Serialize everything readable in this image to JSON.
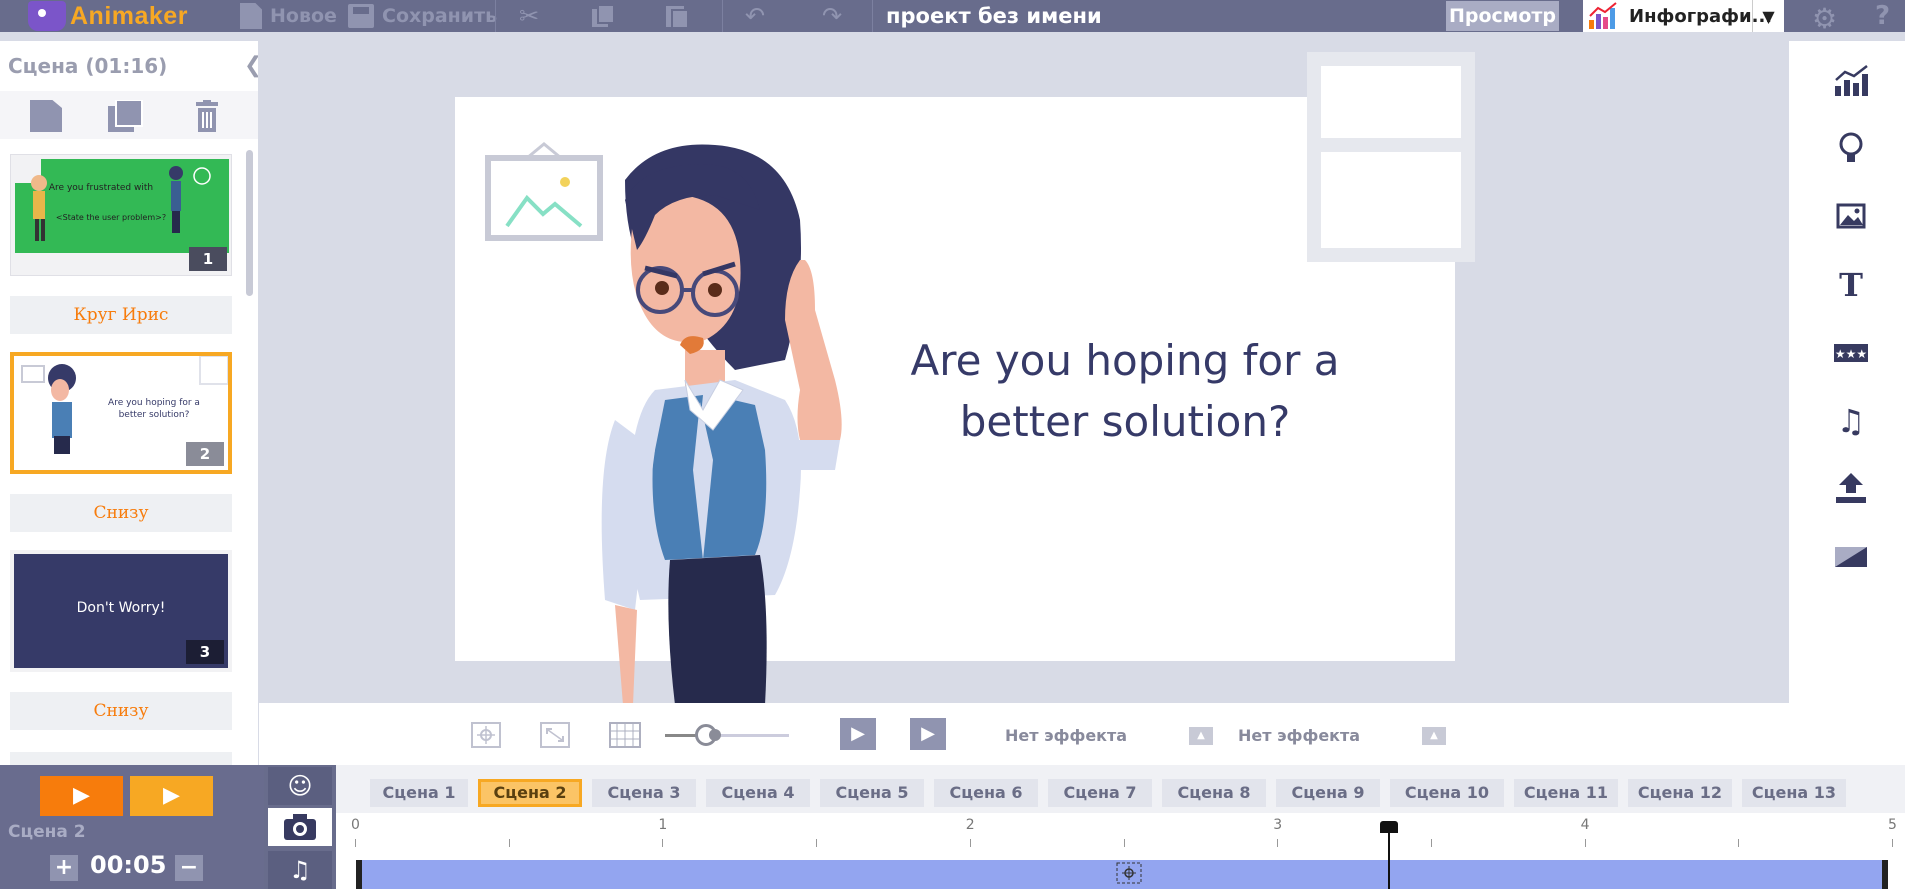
{
  "app": {
    "logo": "Animaker",
    "project_title": "проект без имени"
  },
  "toolbar": {
    "new_label": "Новое",
    "save_label": "Сохранить",
    "preview_label": "Просмотр",
    "theme_label": "Инфографи..."
  },
  "left_panel": {
    "title": "Сцена  (01:16)",
    "scenes": [
      {
        "num": "1",
        "line1": "Are you frustrated with",
        "line2": "<State the user problem>?"
      },
      {
        "num": "2",
        "line1": "Are you hoping for a",
        "line2": "better solution?"
      },
      {
        "num": "3",
        "line1": "Don't Worry!"
      }
    ],
    "transitions": [
      "Круг Ирис",
      "Снизу",
      "Снизу"
    ]
  },
  "canvas": {
    "slide_text_line1": "Are you hoping for a",
    "slide_text_line2": "better solution?"
  },
  "controls": {
    "effect_in": "Нет эффекта",
    "effect_out": "Нет эффекта",
    "zoom_level": 0.33
  },
  "timeline": {
    "current_scene": "Сцена 2",
    "duration": "00:05",
    "tabs": [
      "Сцена 1",
      "Сцена 2",
      "Сцена 3",
      "Сцена 4",
      "Сцена 5",
      "Сцена 6",
      "Сцена 7",
      "Сцена 8",
      "Сцена 9",
      "Сцена 10",
      "Сцена 11",
      "Сцена 12",
      "Сцена 13"
    ],
    "active_tab": 1,
    "ruler": [
      "0",
      "1",
      "2",
      "3",
      "4",
      "5"
    ],
    "playhead_seconds": 3.3
  },
  "colors": {
    "accent": "#f7a823",
    "accent2": "#f77c0c",
    "toolbar": "#686c8c",
    "green_scene": "#33b955",
    "navy": "#363a68",
    "clip": "#93a5f0"
  }
}
